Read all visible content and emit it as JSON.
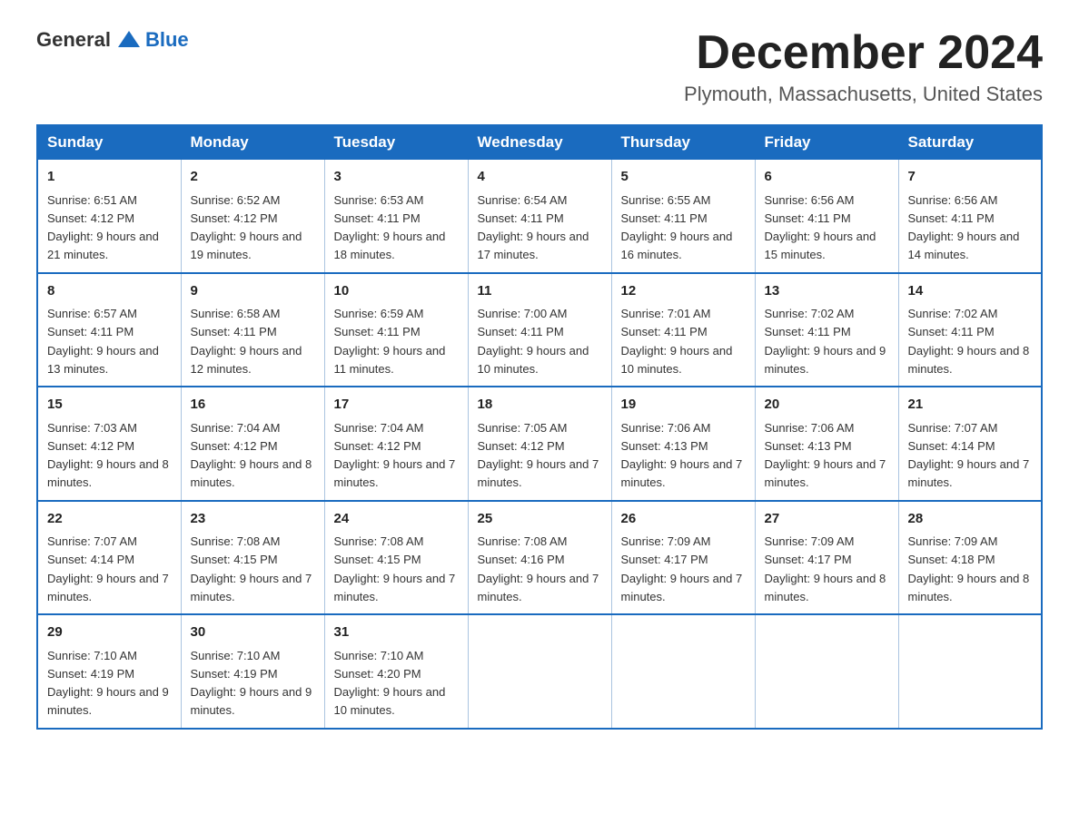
{
  "header": {
    "logo_general": "General",
    "logo_blue": "Blue",
    "month": "December 2024",
    "location": "Plymouth, Massachusetts, United States"
  },
  "weekdays": [
    "Sunday",
    "Monday",
    "Tuesday",
    "Wednesday",
    "Thursday",
    "Friday",
    "Saturday"
  ],
  "weeks": [
    [
      {
        "day": "1",
        "sunrise": "6:51 AM",
        "sunset": "4:12 PM",
        "daylight": "9 hours and 21 minutes."
      },
      {
        "day": "2",
        "sunrise": "6:52 AM",
        "sunset": "4:12 PM",
        "daylight": "9 hours and 19 minutes."
      },
      {
        "day": "3",
        "sunrise": "6:53 AM",
        "sunset": "4:11 PM",
        "daylight": "9 hours and 18 minutes."
      },
      {
        "day": "4",
        "sunrise": "6:54 AM",
        "sunset": "4:11 PM",
        "daylight": "9 hours and 17 minutes."
      },
      {
        "day": "5",
        "sunrise": "6:55 AM",
        "sunset": "4:11 PM",
        "daylight": "9 hours and 16 minutes."
      },
      {
        "day": "6",
        "sunrise": "6:56 AM",
        "sunset": "4:11 PM",
        "daylight": "9 hours and 15 minutes."
      },
      {
        "day": "7",
        "sunrise": "6:56 AM",
        "sunset": "4:11 PM",
        "daylight": "9 hours and 14 minutes."
      }
    ],
    [
      {
        "day": "8",
        "sunrise": "6:57 AM",
        "sunset": "4:11 PM",
        "daylight": "9 hours and 13 minutes."
      },
      {
        "day": "9",
        "sunrise": "6:58 AM",
        "sunset": "4:11 PM",
        "daylight": "9 hours and 12 minutes."
      },
      {
        "day": "10",
        "sunrise": "6:59 AM",
        "sunset": "4:11 PM",
        "daylight": "9 hours and 11 minutes."
      },
      {
        "day": "11",
        "sunrise": "7:00 AM",
        "sunset": "4:11 PM",
        "daylight": "9 hours and 10 minutes."
      },
      {
        "day": "12",
        "sunrise": "7:01 AM",
        "sunset": "4:11 PM",
        "daylight": "9 hours and 10 minutes."
      },
      {
        "day": "13",
        "sunrise": "7:02 AM",
        "sunset": "4:11 PM",
        "daylight": "9 hours and 9 minutes."
      },
      {
        "day": "14",
        "sunrise": "7:02 AM",
        "sunset": "4:11 PM",
        "daylight": "9 hours and 8 minutes."
      }
    ],
    [
      {
        "day": "15",
        "sunrise": "7:03 AM",
        "sunset": "4:12 PM",
        "daylight": "9 hours and 8 minutes."
      },
      {
        "day": "16",
        "sunrise": "7:04 AM",
        "sunset": "4:12 PM",
        "daylight": "9 hours and 8 minutes."
      },
      {
        "day": "17",
        "sunrise": "7:04 AM",
        "sunset": "4:12 PM",
        "daylight": "9 hours and 7 minutes."
      },
      {
        "day": "18",
        "sunrise": "7:05 AM",
        "sunset": "4:12 PM",
        "daylight": "9 hours and 7 minutes."
      },
      {
        "day": "19",
        "sunrise": "7:06 AM",
        "sunset": "4:13 PM",
        "daylight": "9 hours and 7 minutes."
      },
      {
        "day": "20",
        "sunrise": "7:06 AM",
        "sunset": "4:13 PM",
        "daylight": "9 hours and 7 minutes."
      },
      {
        "day": "21",
        "sunrise": "7:07 AM",
        "sunset": "4:14 PM",
        "daylight": "9 hours and 7 minutes."
      }
    ],
    [
      {
        "day": "22",
        "sunrise": "7:07 AM",
        "sunset": "4:14 PM",
        "daylight": "9 hours and 7 minutes."
      },
      {
        "day": "23",
        "sunrise": "7:08 AM",
        "sunset": "4:15 PM",
        "daylight": "9 hours and 7 minutes."
      },
      {
        "day": "24",
        "sunrise": "7:08 AM",
        "sunset": "4:15 PM",
        "daylight": "9 hours and 7 minutes."
      },
      {
        "day": "25",
        "sunrise": "7:08 AM",
        "sunset": "4:16 PM",
        "daylight": "9 hours and 7 minutes."
      },
      {
        "day": "26",
        "sunrise": "7:09 AM",
        "sunset": "4:17 PM",
        "daylight": "9 hours and 7 minutes."
      },
      {
        "day": "27",
        "sunrise": "7:09 AM",
        "sunset": "4:17 PM",
        "daylight": "9 hours and 8 minutes."
      },
      {
        "day": "28",
        "sunrise": "7:09 AM",
        "sunset": "4:18 PM",
        "daylight": "9 hours and 8 minutes."
      }
    ],
    [
      {
        "day": "29",
        "sunrise": "7:10 AM",
        "sunset": "4:19 PM",
        "daylight": "9 hours and 9 minutes."
      },
      {
        "day": "30",
        "sunrise": "7:10 AM",
        "sunset": "4:19 PM",
        "daylight": "9 hours and 9 minutes."
      },
      {
        "day": "31",
        "sunrise": "7:10 AM",
        "sunset": "4:20 PM",
        "daylight": "9 hours and 10 minutes."
      },
      null,
      null,
      null,
      null
    ]
  ]
}
